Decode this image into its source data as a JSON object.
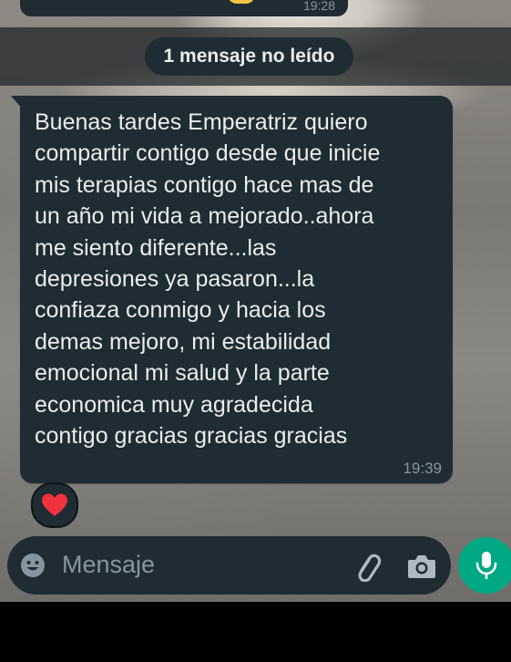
{
  "prev_message": {
    "time": "19:28"
  },
  "unread_divider": {
    "label": "1 mensaje no leído"
  },
  "message": {
    "lines": [
      "Buenas tardes  Emperatriz quiero",
      "compartir contigo desde que inicie",
      "mis terapias contigo hace mas de",
      "un año mi vida a mejorado..ahora",
      "me siento diferente...las",
      "depresiones ya pasaron...la",
      "confiaza conmigo y hacia los",
      "demas mejoro, mi estabilidad",
      "emocional mi salud y la parte",
      "economica muy agradecida",
      "contigo gracias gracias gracias"
    ],
    "time": "19:39",
    "reaction": "heart-icon"
  },
  "composer": {
    "placeholder": "Mensaje",
    "icons": [
      "emoji-icon",
      "paperclip-icon",
      "camera-icon",
      "microphone-icon"
    ]
  },
  "colors": {
    "bubble": "#1f2c33",
    "accent": "#00a884",
    "text": "#e9edef",
    "meta": "#8696a0",
    "heart": "#f0323c"
  }
}
